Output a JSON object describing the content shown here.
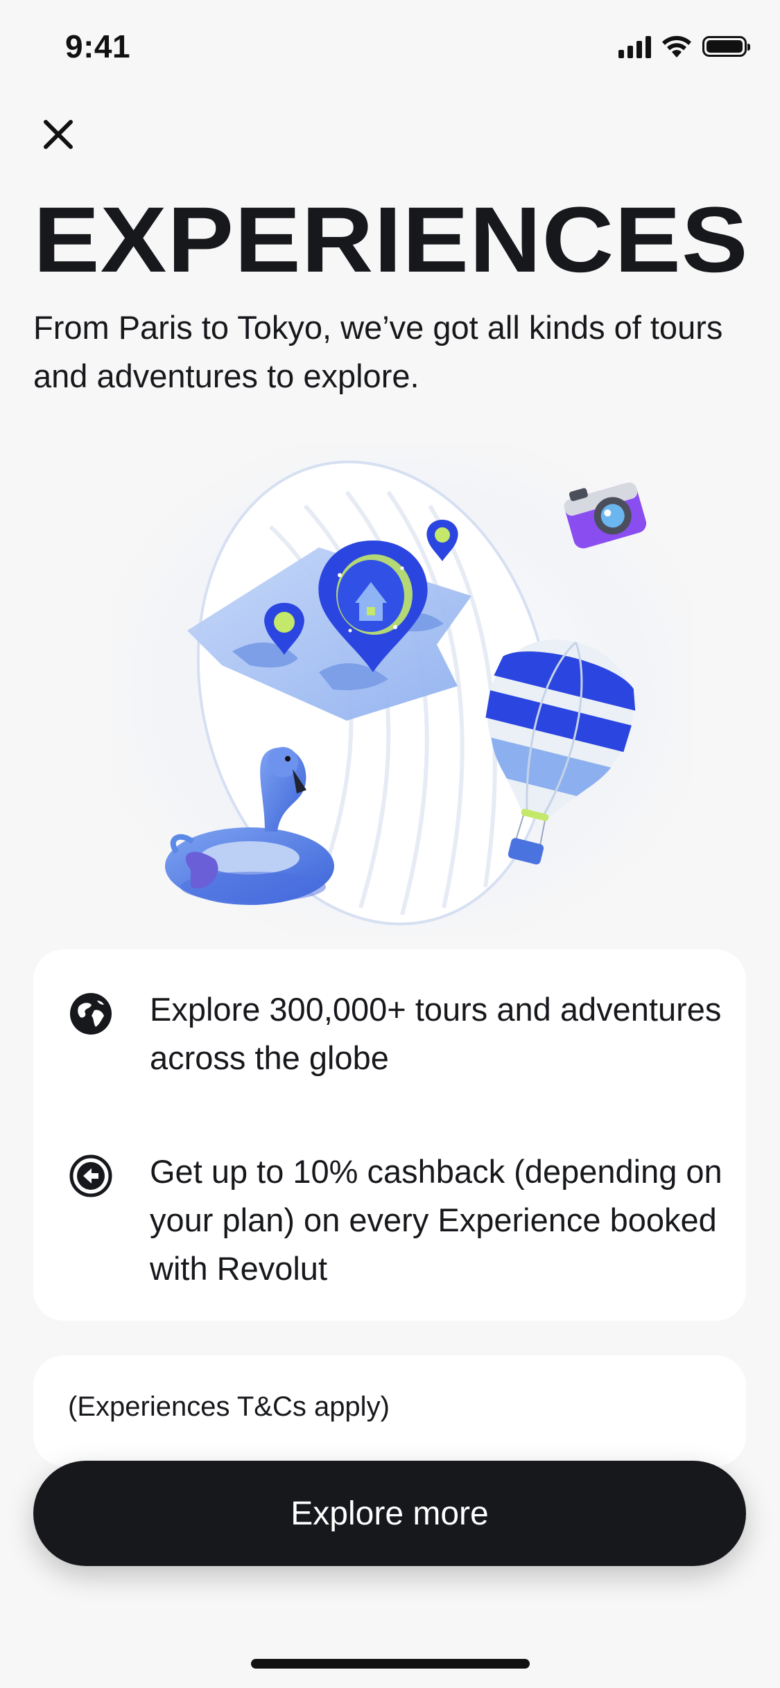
{
  "status_bar": {
    "time": "9:41"
  },
  "header": {
    "close_icon": "close-icon",
    "title": "EXPERIENCES",
    "subtitle": "From Paris to Tokyo, we’ve got all kinds of tours and adventures to explore."
  },
  "illustration": {
    "elements": [
      "map-with-location-pins",
      "camera",
      "hot-air-balloon",
      "flamingo-float"
    ]
  },
  "features": [
    {
      "icon": "globe-icon",
      "text": "Explore 300,000+ tours and adventures across the globe"
    },
    {
      "icon": "cashback-icon",
      "text": "Get up to 10% cashback (depending on your plan) on every Experience booked with Revolut"
    }
  ],
  "terms": {
    "text": "(Experiences T&Cs apply)"
  },
  "cta": {
    "label": "Explore more"
  },
  "colors": {
    "background": "#f7f7f7",
    "card": "#ffffff",
    "text": "#17181c",
    "button": "#17181c",
    "accent_blue": "#2b45e0"
  }
}
